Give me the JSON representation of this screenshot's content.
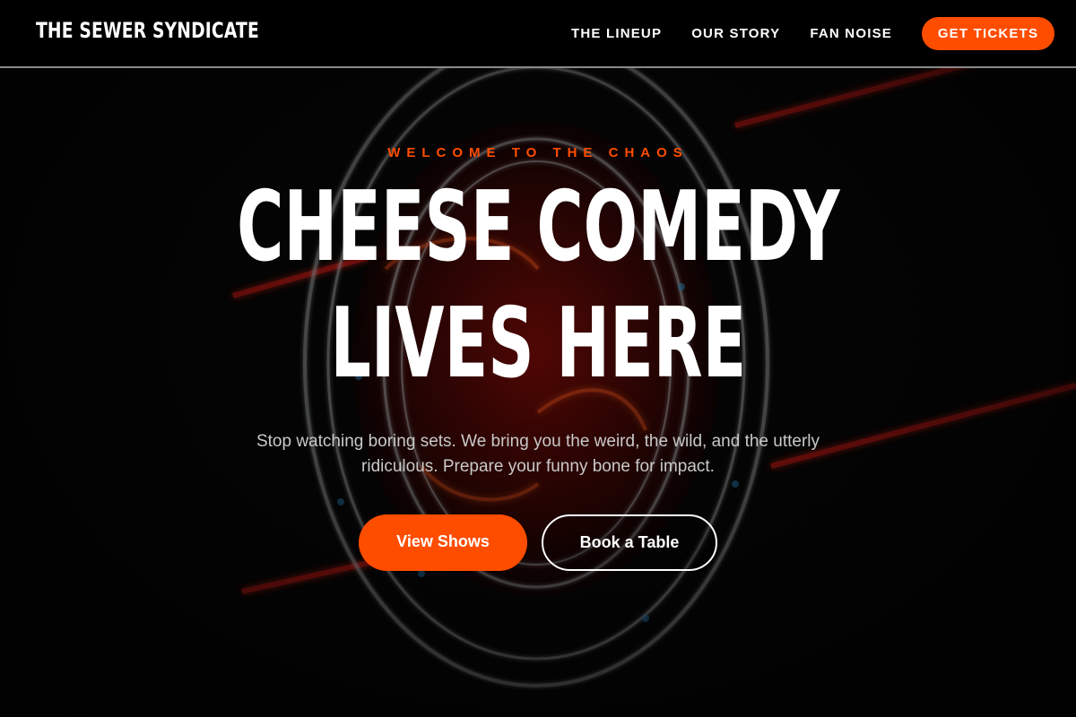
{
  "nav": {
    "brand": "THE SEWER SYNDICATE",
    "links": [
      "THE LINEUP",
      "OUR STORY",
      "FAN NOISE"
    ],
    "cta_label": "GET TICKETS"
  },
  "hero": {
    "eyebrow": "WELCOME TO THE CHAOS",
    "headline_line1": "CHEESE COMEDY",
    "headline_line2": "LIVES HERE",
    "subtext": "Stop watching boring sets. We bring you the weird, the wild, and the utterly ridiculous. Prepare your funny bone for impact.",
    "primary_button": "View Shows",
    "secondary_button": "Book a Table"
  },
  "background": {
    "image": "neon-comedy-store-sign"
  },
  "colors": {
    "accent": "#ff4d00",
    "nav_bg": "#000000",
    "text": "#ffffff",
    "subtext": "#c9c9c9"
  }
}
